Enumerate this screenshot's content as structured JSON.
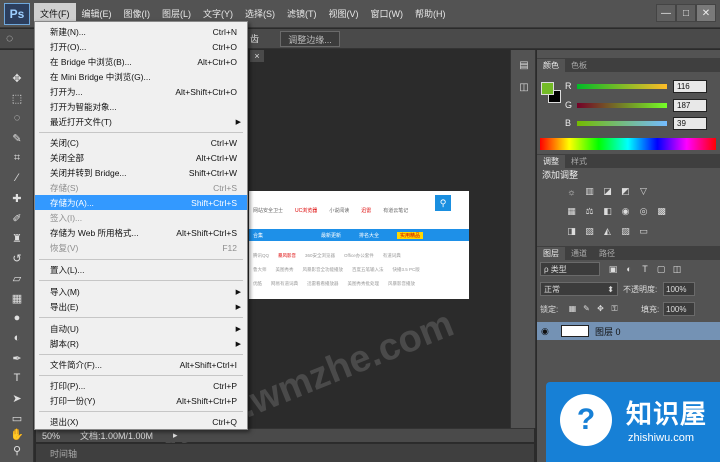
{
  "app": {
    "logo": "Ps"
  },
  "menubar": {
    "items": [
      "文件(F)",
      "编辑(E)",
      "图像(I)",
      "图层(L)",
      "文字(Y)",
      "选择(S)",
      "滤镜(T)",
      "视图(V)",
      "窗口(W)",
      "帮助(H)"
    ],
    "active_index": 0
  },
  "window_controls": {
    "minimize": "—",
    "maximize": "□",
    "close": "✕"
  },
  "optionsbar": {
    "refine_left": "齿",
    "refine_edge": "调整边缘..."
  },
  "file_menu": {
    "items": [
      {
        "label": "新建(N)...",
        "shortcut": "Ctrl+N",
        "state": "normal"
      },
      {
        "label": "打开(O)...",
        "shortcut": "Ctrl+O",
        "state": "normal"
      },
      {
        "label": "在 Bridge 中浏览(B)...",
        "shortcut": "Alt+Ctrl+O",
        "state": "normal"
      },
      {
        "label": "在 Mini Bridge 中浏览(G)...",
        "shortcut": "",
        "state": "normal"
      },
      {
        "label": "打开为...",
        "shortcut": "Alt+Shift+Ctrl+O",
        "state": "normal"
      },
      {
        "label": "打开为智能对象...",
        "shortcut": "",
        "state": "normal"
      },
      {
        "label": "最近打开文件(T)",
        "shortcut": "",
        "state": "submenu"
      },
      {
        "label": "关闭(C)",
        "shortcut": "Ctrl+W",
        "state": "normal"
      },
      {
        "label": "关闭全部",
        "shortcut": "Alt+Ctrl+W",
        "state": "normal"
      },
      {
        "label": "关闭并转到 Bridge...",
        "shortcut": "Shift+Ctrl+W",
        "state": "normal"
      },
      {
        "label": "存储(S)",
        "shortcut": "Ctrl+S",
        "state": "disabled"
      },
      {
        "label": "存储为(A)...",
        "shortcut": "Shift+Ctrl+S",
        "state": "highlight"
      },
      {
        "label": "签入(I)...",
        "shortcut": "",
        "state": "disabled"
      },
      {
        "label": "存储为 Web 所用格式...",
        "shortcut": "Alt+Shift+Ctrl+S",
        "state": "normal"
      },
      {
        "label": "恢复(V)",
        "shortcut": "F12",
        "state": "disabled"
      },
      {
        "label": "置入(L)...",
        "shortcut": "",
        "state": "normal"
      },
      {
        "label": "导入(M)",
        "shortcut": "",
        "state": "submenu"
      },
      {
        "label": "导出(E)",
        "shortcut": "",
        "state": "submenu"
      },
      {
        "label": "自动(U)",
        "shortcut": "",
        "state": "submenu"
      },
      {
        "label": "脚本(R)",
        "shortcut": "",
        "state": "submenu"
      },
      {
        "label": "文件简介(F)...",
        "shortcut": "Alt+Shift+Ctrl+I",
        "state": "normal"
      },
      {
        "label": "打印(P)...",
        "shortcut": "Ctrl+P",
        "state": "normal"
      },
      {
        "label": "打印一份(Y)",
        "shortcut": "Alt+Shift+Ctrl+P",
        "state": "normal"
      },
      {
        "label": "退出(X)",
        "shortcut": "Ctrl+Q",
        "state": "normal"
      }
    ]
  },
  "document": {
    "tab_close": "×",
    "top_links": [
      "网站安全卫士",
      "UC浏览器",
      "小说阅读",
      "迅雷",
      "有道云笔记"
    ],
    "search_icon": "⚲",
    "nav_left": "合集",
    "nav_items": [
      "最新更新",
      "排名大全",
      "实用精品"
    ],
    "link_rows": [
      [
        "腾讯QQ",
        "暴风影音",
        "360安全浏览器",
        "Office办公套件",
        "有道词典"
      ],
      [
        "鲁大师",
        "美图秀秀",
        "风暴影音全功能播放",
        "百度五笔输入法",
        "快播3.5 PC版"
      ],
      [
        "优酷",
        "网易有道词典",
        "迅雷看看播放器",
        "美图秀秀批处理",
        "风暴影音播放"
      ]
    ]
  },
  "statusbar": {
    "zoom": "50%",
    "doc_info": "文档:1.00M/1.00M",
    "arrow": "▸"
  },
  "timeline": {
    "label": "时间轴"
  },
  "color_panel": {
    "tabs": [
      "颜色",
      "色板"
    ],
    "fg_color": "#74bb27",
    "channels": [
      {
        "label": "R",
        "value": "116"
      },
      {
        "label": "G",
        "value": "187"
      },
      {
        "label": "B",
        "value": "39"
      }
    ]
  },
  "adjust_panel": {
    "tabs": [
      "调整",
      "样式"
    ],
    "title": "添加调整"
  },
  "layers_panel": {
    "tabs": [
      "图层",
      "通道",
      "路径"
    ],
    "filter": "ρ 类型",
    "blend_mode": "正常",
    "opacity_label": "不透明度:",
    "opacity": "100%",
    "lock_label": "锁定:",
    "fill_label": "填充:",
    "fill": "100%",
    "layer_name": "图层 0"
  },
  "badge": {
    "icon": "?",
    "title": "知识屋",
    "url": "zhishiwu.com"
  },
  "watermark": "www.wmzhe.com"
}
